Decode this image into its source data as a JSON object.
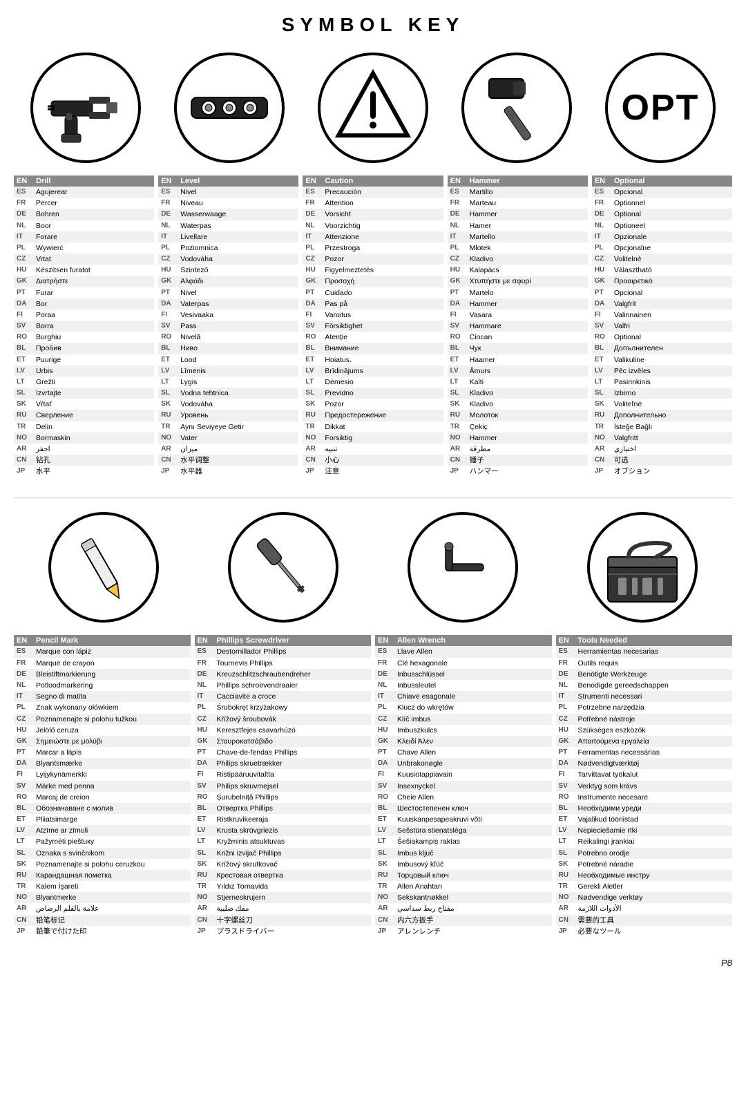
{
  "page": {
    "title": "SYMBOL KEY",
    "page_number": "P8"
  },
  "symbols_top": [
    {
      "id": "drill",
      "icon_type": "drill",
      "translations": [
        [
          "EN",
          "Drill"
        ],
        [
          "ES",
          "Agujerear"
        ],
        [
          "FR",
          "Percer"
        ],
        [
          "DE",
          "Bohren"
        ],
        [
          "NL",
          "Boor"
        ],
        [
          "IT",
          "Forare"
        ],
        [
          "PL",
          "Wywierć"
        ],
        [
          "CZ",
          "Vrtat"
        ],
        [
          "HU",
          "Készítsen furatot"
        ],
        [
          "GK",
          "Διατρήστε"
        ],
        [
          "PT",
          "Furar"
        ],
        [
          "DA",
          "Bor"
        ],
        [
          "FI",
          "Poraa"
        ],
        [
          "SV",
          "Borra"
        ],
        [
          "RO",
          "Burghiu"
        ],
        [
          "BL",
          "Пробив"
        ],
        [
          "ET",
          "Puurige"
        ],
        [
          "LV",
          "Urbis"
        ],
        [
          "LT",
          "Grežti"
        ],
        [
          "SL",
          "Izvrtajte"
        ],
        [
          "SK",
          "Vŕtať"
        ],
        [
          "RU",
          "Сверление"
        ],
        [
          "TR",
          "Delin"
        ],
        [
          "NO",
          "Bormaskin"
        ],
        [
          "AR",
          "احفر"
        ],
        [
          "CN",
          "钻孔"
        ],
        [
          "JP",
          "水平"
        ]
      ]
    },
    {
      "id": "level",
      "icon_type": "level",
      "translations": [
        [
          "EN",
          "Level"
        ],
        [
          "ES",
          "Nivel"
        ],
        [
          "FR",
          "Niveau"
        ],
        [
          "DE",
          "Wasserwaage"
        ],
        [
          "NL",
          "Waterpas"
        ],
        [
          "IT",
          "Livellare"
        ],
        [
          "PL",
          "Poziomnica"
        ],
        [
          "CZ",
          "Vodováha"
        ],
        [
          "HU",
          "Szintező"
        ],
        [
          "GK",
          "Αλφάδι"
        ],
        [
          "PT",
          "Nivel"
        ],
        [
          "DA",
          "Vaterpas"
        ],
        [
          "FI",
          "Vesivaaka"
        ],
        [
          "SV",
          "Pass"
        ],
        [
          "RO",
          "Nivelă"
        ],
        [
          "BL",
          "Ниво"
        ],
        [
          "ET",
          "Lood"
        ],
        [
          "LV",
          "Līmenis"
        ],
        [
          "LT",
          "Lygis"
        ],
        [
          "SL",
          "Vodna tehtnica"
        ],
        [
          "SK",
          "Vodováha"
        ],
        [
          "RU",
          "Уровень"
        ],
        [
          "TR",
          "Aynı Seviyeye Getir"
        ],
        [
          "NO",
          "Vater"
        ],
        [
          "AR",
          "ميزان"
        ],
        [
          "CN",
          "水平调整"
        ],
        [
          "JP",
          "水平器"
        ]
      ]
    },
    {
      "id": "caution",
      "icon_type": "caution",
      "translations": [
        [
          "EN",
          "Caution"
        ],
        [
          "ES",
          "Precaución"
        ],
        [
          "FR",
          "Attention"
        ],
        [
          "DE",
          "Vorsicht"
        ],
        [
          "NL",
          "Voorzichtig"
        ],
        [
          "IT",
          "Attenzione"
        ],
        [
          "PL",
          "Przestroga"
        ],
        [
          "CZ",
          "Pozor"
        ],
        [
          "HU",
          "Figyelmeztetés"
        ],
        [
          "GK",
          "Προσοχή"
        ],
        [
          "PT",
          "Cuidado"
        ],
        [
          "DA",
          "Pas på"
        ],
        [
          "FI",
          "Varoitus"
        ],
        [
          "SV",
          "Försiktighet"
        ],
        [
          "RO",
          "Atenție"
        ],
        [
          "BL",
          "Внимание"
        ],
        [
          "ET",
          "Hoiatus."
        ],
        [
          "LV",
          "Brīdinājums"
        ],
        [
          "LT",
          "Dėmesio"
        ],
        [
          "SL",
          "Previdno"
        ],
        [
          "SK",
          "Pozor"
        ],
        [
          "RU",
          "Предостережение"
        ],
        [
          "TR",
          "Dikkat"
        ],
        [
          "NO",
          "Forsiktig"
        ],
        [
          "AR",
          "تنبيه"
        ],
        [
          "CN",
          "小心"
        ],
        [
          "JP",
          "注意"
        ]
      ]
    },
    {
      "id": "hammer",
      "icon_type": "hammer",
      "translations": [
        [
          "EN",
          "Hammer"
        ],
        [
          "ES",
          "Martillo"
        ],
        [
          "FR",
          "Marteau"
        ],
        [
          "DE",
          "Hammer"
        ],
        [
          "NL",
          "Hamer"
        ],
        [
          "IT",
          "Martello"
        ],
        [
          "PL",
          "Młotek"
        ],
        [
          "CZ",
          "Kladivo"
        ],
        [
          "HU",
          "Kalapács"
        ],
        [
          "GK",
          "Χτυπήστε με σφυρί"
        ],
        [
          "PT",
          "Martelo"
        ],
        [
          "DA",
          "Hammer"
        ],
        [
          "FI",
          "Vasara"
        ],
        [
          "SV",
          "Hammare"
        ],
        [
          "RO",
          "Ciocan"
        ],
        [
          "BL",
          "Чук"
        ],
        [
          "ET",
          "Haamer"
        ],
        [
          "LV",
          "Āmurs"
        ],
        [
          "LT",
          "Kalti"
        ],
        [
          "SL",
          "Kladivo"
        ],
        [
          "SK",
          "Kladivo"
        ],
        [
          "RU",
          "Молоток"
        ],
        [
          "TR",
          "Çekiç"
        ],
        [
          "NO",
          "Hammer"
        ],
        [
          "AR",
          "مطرقة"
        ],
        [
          "CN",
          "锤子"
        ],
        [
          "JP",
          "ハンマー"
        ]
      ]
    },
    {
      "id": "optional",
      "icon_type": "opt",
      "translations": [
        [
          "EN",
          "Optional"
        ],
        [
          "ES",
          "Opcional"
        ],
        [
          "FR",
          "Optionnel"
        ],
        [
          "DE",
          "Optional"
        ],
        [
          "NL",
          "Optioneel"
        ],
        [
          "IT",
          "Opzionale"
        ],
        [
          "PL",
          "Opcjonalne"
        ],
        [
          "CZ",
          "Volitelné"
        ],
        [
          "HU",
          "Választható"
        ],
        [
          "GK",
          "Προαιρετικό"
        ],
        [
          "PT",
          "Opcional"
        ],
        [
          "DA",
          "Valgfrit"
        ],
        [
          "FI",
          "Valinnainen"
        ],
        [
          "SV",
          "Valfri"
        ],
        [
          "RO",
          "Optional"
        ],
        [
          "BL",
          "Допълнителен"
        ],
        [
          "ET",
          "Valikuline"
        ],
        [
          "LV",
          "Pēc izvēles"
        ],
        [
          "LT",
          "Pasirinkinis"
        ],
        [
          "SL",
          "Izbirno"
        ],
        [
          "SK",
          "Voliteľné"
        ],
        [
          "RU",
          "Дополнительно"
        ],
        [
          "TR",
          "İsteğe Bağlı"
        ],
        [
          "NO",
          "Valgfritt"
        ],
        [
          "AR",
          "اختياري"
        ],
        [
          "CN",
          "可选"
        ],
        [
          "JP",
          "オプション"
        ]
      ]
    }
  ],
  "symbols_bottom": [
    {
      "id": "pencil_mark",
      "icon_type": "pencil",
      "translations": [
        [
          "EN",
          "Pencil Mark"
        ],
        [
          "ES",
          "Marque con lápiz"
        ],
        [
          "FR",
          "Marque de crayon"
        ],
        [
          "DE",
          "Bleistiftmarkierung"
        ],
        [
          "NL",
          "Potloodmarkering"
        ],
        [
          "IT",
          "Segno di matita"
        ],
        [
          "PL",
          "Znak wykonany ołówkiem"
        ],
        [
          "CZ",
          "Poznamenajte si polohu tužkou"
        ],
        [
          "HU",
          "Jelölő ceruza"
        ],
        [
          "GK",
          "Σημειώστε με μολύβι"
        ],
        [
          "PT",
          "Marcar a lápis"
        ],
        [
          "DA",
          "Blyantsmærke"
        ],
        [
          "FI",
          "Lyijykynämerkki"
        ],
        [
          "SV",
          "Märke med penna"
        ],
        [
          "RO",
          "Marcaj de creion"
        ],
        [
          "BL",
          "Обозначаване с молив"
        ],
        [
          "ET",
          "Pliiatsimärge"
        ],
        [
          "LV",
          "Atzīme ar zīmuli"
        ],
        [
          "LT",
          "Pažymėti pieštuку"
        ],
        [
          "SL",
          "Oznaka s svinčnikom"
        ],
        [
          "SK",
          "Poznamenajte si polohu ceruzkou"
        ],
        [
          "RU",
          "Карандашная пометка"
        ],
        [
          "TR",
          "Kalem İşareti"
        ],
        [
          "NO",
          "Blyantmerke"
        ],
        [
          "AR",
          "علامة بالقلم الرصاص"
        ],
        [
          "CN",
          "铅笔标记"
        ],
        [
          "JP",
          "鉛筆で付けた印"
        ]
      ]
    },
    {
      "id": "phillips_screwdriver",
      "icon_type": "phillips",
      "translations": [
        [
          "EN",
          "Phillips Screwdriver"
        ],
        [
          "ES",
          "Destornillador Phillips"
        ],
        [
          "FR",
          "Tournevis Phillips"
        ],
        [
          "DE",
          "Kreuzschlitzschraubendreher"
        ],
        [
          "NL",
          "Phillips schroevendraaier"
        ],
        [
          "IT",
          "Cacciavite a croce"
        ],
        [
          "PL",
          "Śrubokręt krzyżakowy"
        ],
        [
          "CZ",
          "Křížový šroubovák"
        ],
        [
          "HU",
          "Keresztfejes csavarhúzó"
        ],
        [
          "GK",
          "Σταυροκατσάβιδο"
        ],
        [
          "PT",
          "Chave-de-fendas Phillips"
        ],
        [
          "DA",
          "Philips skruetrækker"
        ],
        [
          "FI",
          "Ristipääruuvitaltta"
        ],
        [
          "SV",
          "Philips skruvmejsel"
        ],
        [
          "RO",
          "Șurubelniță Phillips"
        ],
        [
          "BL",
          "Отвертка Phillips"
        ],
        [
          "ET",
          "Ristkruvikeeraja"
        ],
        [
          "LV",
          "Krusta skrūvgriezis"
        ],
        [
          "LT",
          "Kryžminis atsuktuvas"
        ],
        [
          "SL",
          "Križni izvijač Phillips"
        ],
        [
          "SK",
          "Krížový skrutkovač"
        ],
        [
          "RU",
          "Крестовая отвертка"
        ],
        [
          "TR",
          "Yıldız Tornavida"
        ],
        [
          "NO",
          "Stjerneskrujern"
        ],
        [
          "AR",
          "مفك صليبة"
        ],
        [
          "CN",
          "十字螺丝刀"
        ],
        [
          "JP",
          "プラスドライバー"
        ]
      ]
    },
    {
      "id": "allen_wrench",
      "icon_type": "allen",
      "translations": [
        [
          "EN",
          "Allen Wrench"
        ],
        [
          "ES",
          "Llave Allen"
        ],
        [
          "FR",
          "Clé hexagonale"
        ],
        [
          "DE",
          "Inbusschlüssel"
        ],
        [
          "NL",
          "Inbussleutel"
        ],
        [
          "IT",
          "Chiave esagonale"
        ],
        [
          "PL",
          "Klucz do wkrętów"
        ],
        [
          "CZ",
          "Klíč imbus"
        ],
        [
          "HU",
          "Imbuszkulcs"
        ],
        [
          "GK",
          "Κλειδί Άλεν"
        ],
        [
          "PT",
          "Chave Allen"
        ],
        [
          "DA",
          "Unbrakonøgle"
        ],
        [
          "FI",
          "Kuusiotappiavain"
        ],
        [
          "SV",
          "Insexnyckel"
        ],
        [
          "RO",
          "Cheie Allen"
        ],
        [
          "BL",
          "Шестостепенен ключ"
        ],
        [
          "ET",
          "Kuuskanpesapeakruvi võti"
        ],
        [
          "LV",
          "Sešstūra stieņatsléga"
        ],
        [
          "LT",
          "Šešiakampis raktas"
        ],
        [
          "SL",
          "Imbus ključ"
        ],
        [
          "SK",
          "Imbusový kľúč"
        ],
        [
          "RU",
          "Торцовый ключ"
        ],
        [
          "TR",
          "Allen Anahtarı"
        ],
        [
          "NO",
          "Sekskantnøkkel"
        ],
        [
          "AR",
          "مفتاح ربط سداسي"
        ],
        [
          "CN",
          "内六方扳手"
        ],
        [
          "JP",
          "アレンレンチ"
        ]
      ]
    },
    {
      "id": "tools_needed",
      "icon_type": "toolbox",
      "translations": [
        [
          "EN",
          "Tools Needed"
        ],
        [
          "ES",
          "Herramientas necesarias"
        ],
        [
          "FR",
          "Outils requis"
        ],
        [
          "DE",
          "Benötigte Werkzeuge"
        ],
        [
          "NL",
          "Benodigde gereedschappen"
        ],
        [
          "IT",
          "Strumenti necessari"
        ],
        [
          "PL",
          "Potrzebne narzędzia"
        ],
        [
          "CZ",
          "Potřebné nástroje"
        ],
        [
          "HU",
          "Szükséges eszközök"
        ],
        [
          "GK",
          "Απαιτούμενα εργαλεία"
        ],
        [
          "PT",
          "Ferramentas necessárias"
        ],
        [
          "DA",
          "Nødvendigtværktøj"
        ],
        [
          "FI",
          "Tarvittavat työkalut"
        ],
        [
          "SV",
          "Verktyg som krävs"
        ],
        [
          "RO",
          "Instrumente necesare"
        ],
        [
          "BL",
          "Необходими уреди"
        ],
        [
          "ET",
          "Vajalikud tööriistad"
        ],
        [
          "LV",
          "Nepieciešamie rīki"
        ],
        [
          "LT",
          "Reikalingi įrankiai"
        ],
        [
          "SL",
          "Potrebno orodje"
        ],
        [
          "SK",
          "Potrebné náradie"
        ],
        [
          "RU",
          "Необходимые инстру"
        ],
        [
          "TR",
          "Gerekli Aletler"
        ],
        [
          "NO",
          "Nødvendige verktøy"
        ],
        [
          "AR",
          "الأدوات اللازمة"
        ],
        [
          "CN",
          "需要的工具"
        ],
        [
          "JP",
          "必要なツール"
        ]
      ]
    }
  ]
}
